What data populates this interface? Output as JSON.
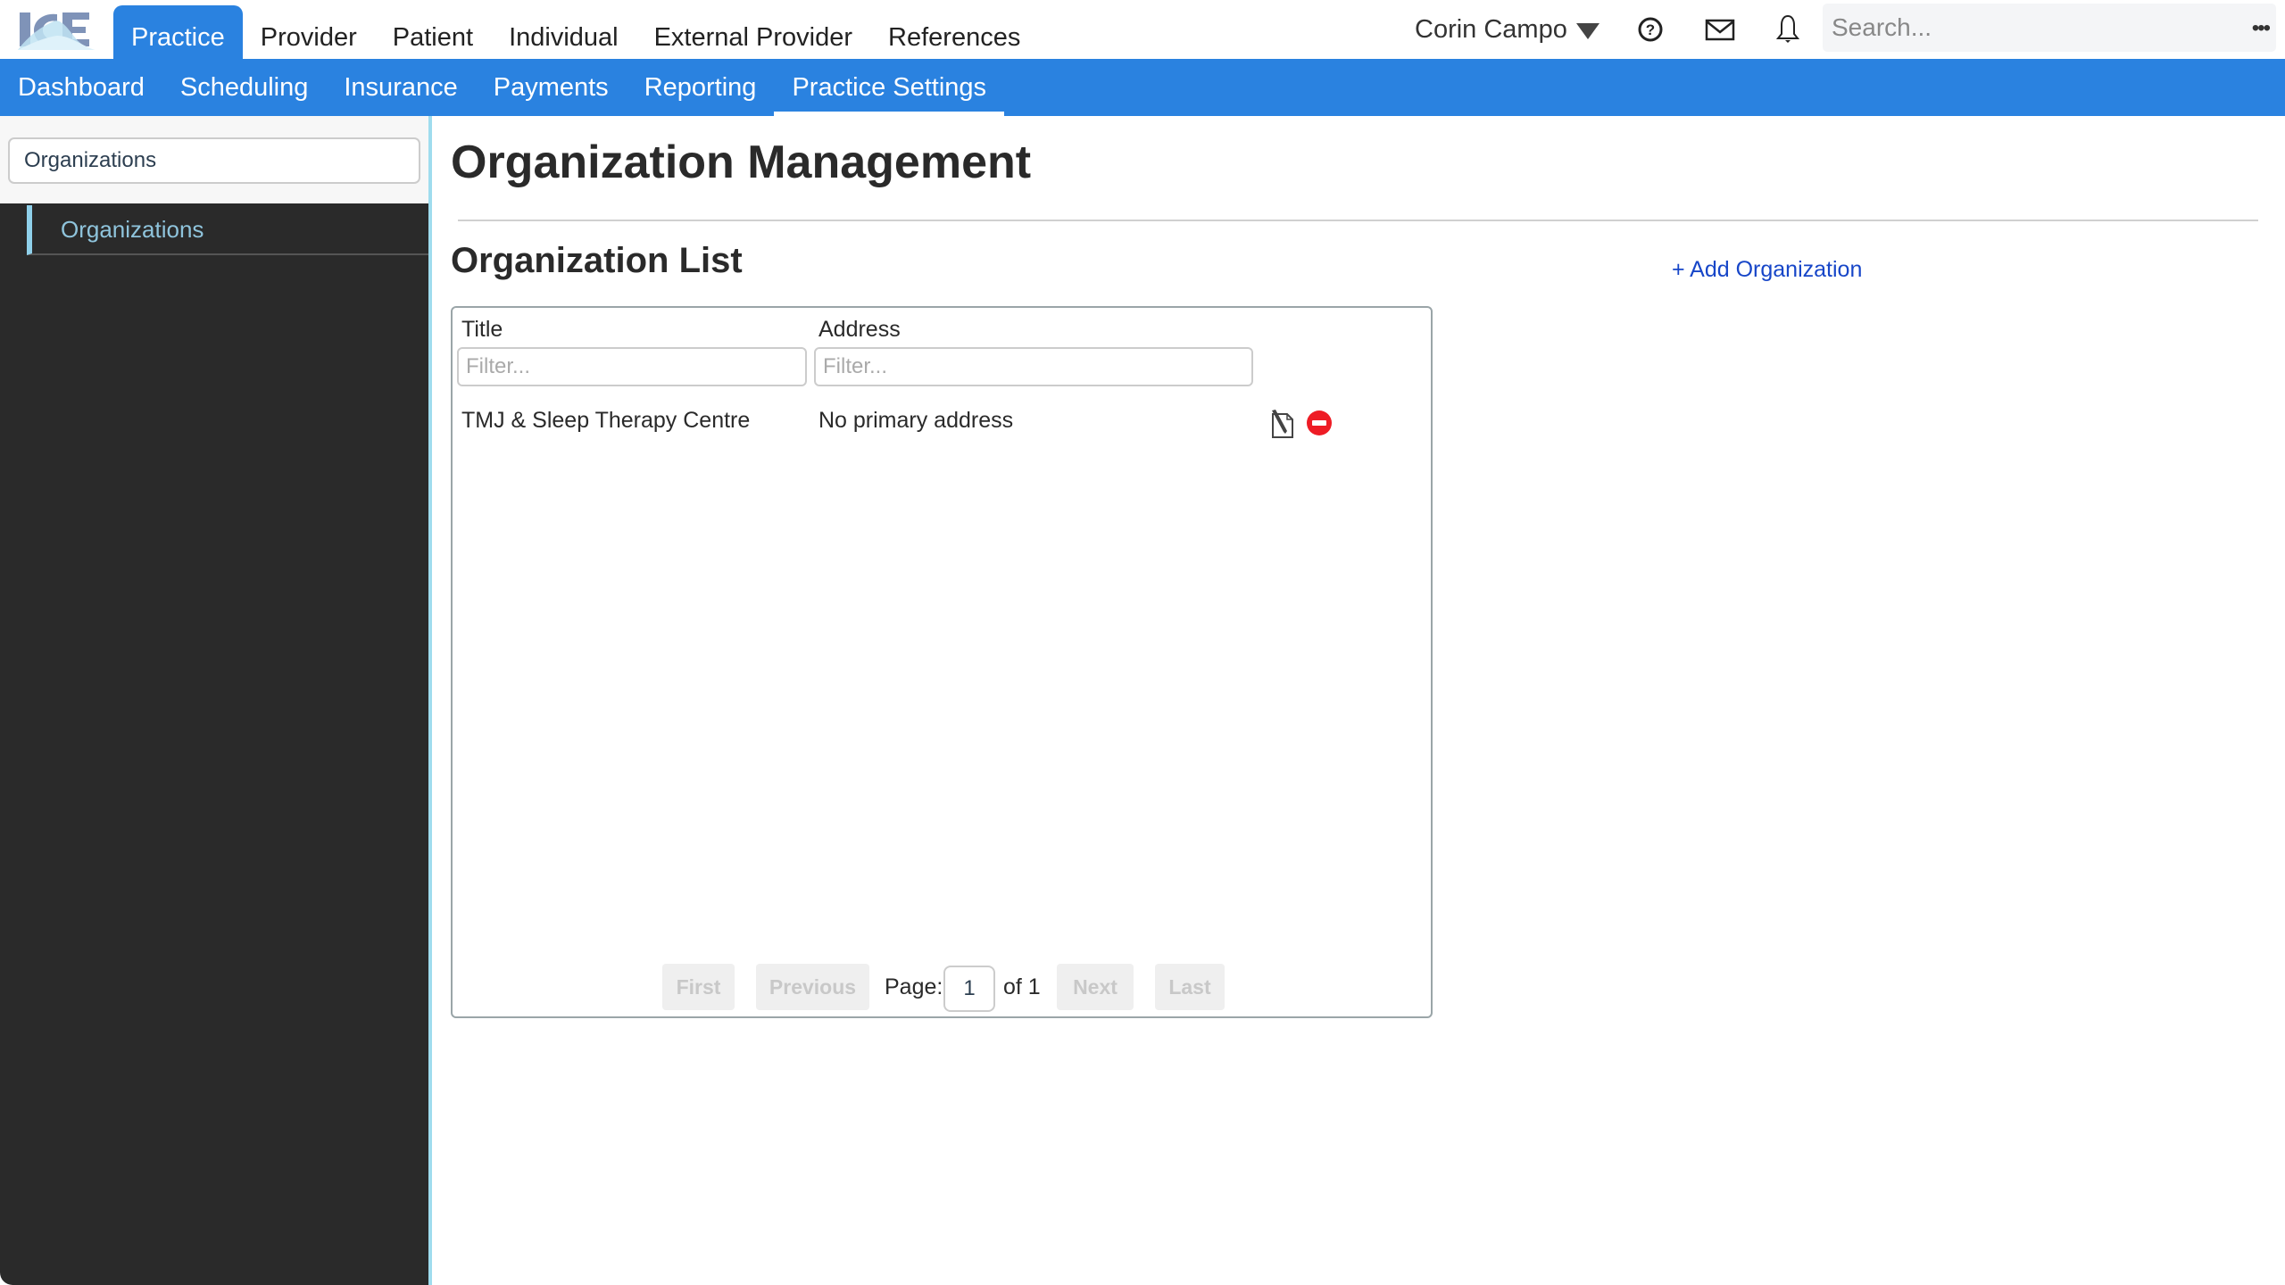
{
  "app": {
    "logo_text": "ICE"
  },
  "top_nav": {
    "tabs": [
      {
        "label": "Practice",
        "active": true
      },
      {
        "label": "Provider"
      },
      {
        "label": "Patient"
      },
      {
        "label": "Individual"
      },
      {
        "label": "External Provider"
      },
      {
        "label": "References"
      }
    ],
    "user_name": "Corin Campo",
    "icons": [
      "help-icon",
      "mail-icon",
      "bell-icon"
    ],
    "search_placeholder": "Search...",
    "more_label": "•••"
  },
  "sub_nav": {
    "items": [
      {
        "label": "Dashboard"
      },
      {
        "label": "Scheduling"
      },
      {
        "label": "Insurance"
      },
      {
        "label": "Payments"
      },
      {
        "label": "Reporting"
      },
      {
        "label": "Practice Settings",
        "active": true
      }
    ]
  },
  "sidebar": {
    "search_value": "Organizations",
    "items": [
      {
        "label": "Organizations",
        "active": true
      }
    ]
  },
  "main": {
    "page_title": "Organization Management",
    "list_title": "Organization List",
    "add_button_label": "+ Add Organization",
    "table": {
      "columns": [
        {
          "header": "Title",
          "filter_placeholder": "Filter..."
        },
        {
          "header": "Address",
          "filter_placeholder": "Filter..."
        }
      ],
      "rows": [
        {
          "title": "TMJ & Sleep Therapy Centre",
          "address": "No primary address"
        }
      ]
    },
    "pagination": {
      "first": "First",
      "previous": "Previous",
      "page_label": "Page:",
      "current_page": "1",
      "of_label": "of 1",
      "next": "Next",
      "last": "Last"
    }
  },
  "colors": {
    "brand_blue": "#2a82e0",
    "sidebar_bg": "#2a2a2a",
    "sidebar_accent": "#8fd0ea",
    "link": "#1746c8",
    "delete_red": "#ee1c25"
  }
}
